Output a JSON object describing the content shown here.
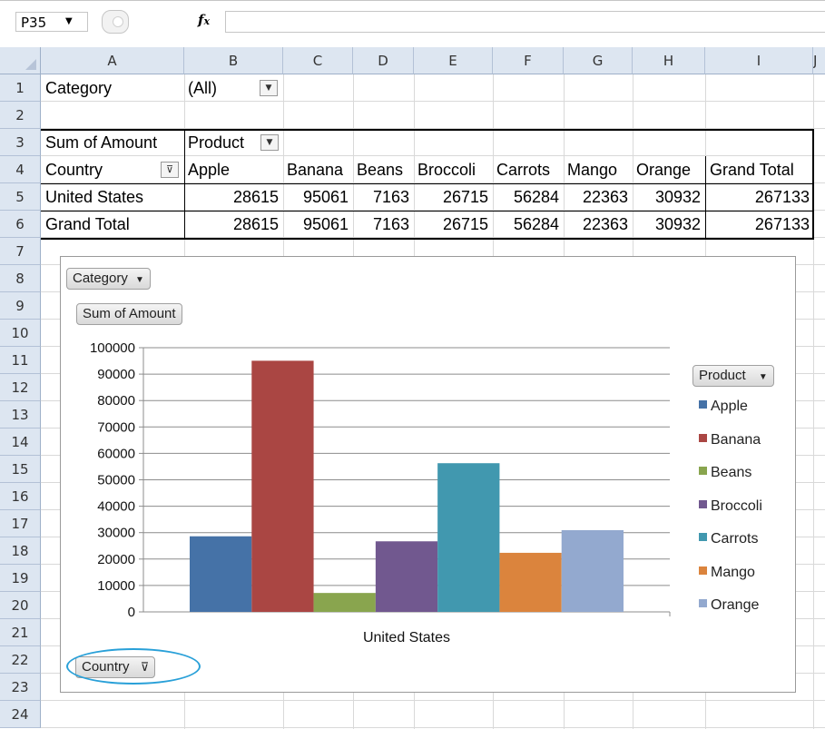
{
  "formula_bar": {
    "name_box": "P35",
    "fx_label": "fx",
    "formula": ""
  },
  "columns": [
    "A",
    "B",
    "C",
    "D",
    "E",
    "F",
    "G",
    "H",
    "I"
  ],
  "rows": [
    "1",
    "2",
    "3",
    "4",
    "5",
    "6",
    "7",
    "8",
    "9",
    "10",
    "11",
    "12",
    "13",
    "14",
    "15",
    "16",
    "17",
    "18",
    "19",
    "20",
    "21",
    "22",
    "23",
    "24"
  ],
  "pivot": {
    "filter_label": "Category",
    "filter_value": "(All)",
    "values_label": "Sum of Amount",
    "column_field": "Product",
    "row_field": "Country",
    "products": [
      "Apple",
      "Banana",
      "Beans",
      "Broccoli",
      "Carrots",
      "Mango",
      "Orange"
    ],
    "grand_total_label": "Grand Total",
    "rows": [
      {
        "label": "United States",
        "values": [
          "28615",
          "95061",
          "7163",
          "26715",
          "56284",
          "22363",
          "30932"
        ],
        "total": "267133"
      },
      {
        "label": "Grand Total",
        "values": [
          "28615",
          "95061",
          "7163",
          "26715",
          "56284",
          "22363",
          "30932"
        ],
        "total": "267133"
      }
    ]
  },
  "chart": {
    "category_button": "Category",
    "sum_button": "Sum of Amount",
    "legend_button": "Product",
    "country_button": "Country"
  },
  "colors": {
    "Apple": "#4572a7",
    "Banana": "#aa4643",
    "Beans": "#89a54e",
    "Broccoli": "#71588f",
    "Carrots": "#4198af",
    "Mango": "#db843d",
    "Orange": "#93a9cf",
    "highlight": "#29a0d8"
  },
  "chart_data": {
    "type": "bar",
    "categories": [
      "United States"
    ],
    "xlabel": "",
    "ylabel": "",
    "ylim": [
      0,
      100000
    ],
    "yticks": [
      "0",
      "10000",
      "20000",
      "30000",
      "40000",
      "50000",
      "60000",
      "70000",
      "80000",
      "90000",
      "100000"
    ],
    "series": [
      {
        "name": "Apple",
        "values": [
          28615
        ]
      },
      {
        "name": "Banana",
        "values": [
          95061
        ]
      },
      {
        "name": "Beans",
        "values": [
          7163
        ]
      },
      {
        "name": "Broccoli",
        "values": [
          26715
        ]
      },
      {
        "name": "Carrots",
        "values": [
          56284
        ]
      },
      {
        "name": "Mango",
        "values": [
          22363
        ]
      },
      {
        "name": "Orange",
        "values": [
          30932
        ]
      }
    ],
    "grid": true,
    "legend": "right"
  }
}
